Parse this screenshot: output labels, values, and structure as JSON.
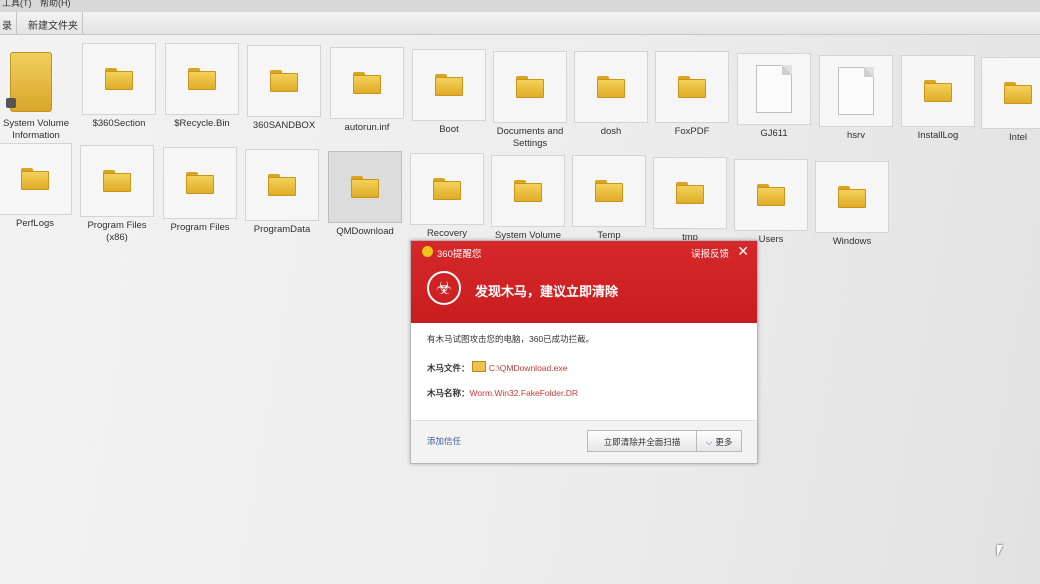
{
  "menubar": {
    "tools": "工具(T)",
    "help": "帮助(H)"
  },
  "toolbar": {
    "left_fragment": "录",
    "new_folder": "新建文件夹"
  },
  "files_row1": [
    {
      "name": "System Volume\nInformation",
      "type": "big-folder"
    },
    {
      "name": "$360Section",
      "type": "folder"
    },
    {
      "name": "$Recycle.Bin",
      "type": "folder"
    },
    {
      "name": "360SANDBOX",
      "type": "folder"
    },
    {
      "name": "autorun.inf",
      "type": "folder"
    },
    {
      "name": "Boot",
      "type": "folder"
    },
    {
      "name": "Documents and\nSettings",
      "type": "folder"
    },
    {
      "name": "dosh",
      "type": "folder"
    },
    {
      "name": "FoxPDF",
      "type": "folder"
    },
    {
      "name": "GJ611",
      "type": "file"
    },
    {
      "name": "hsrv",
      "type": "file"
    },
    {
      "name": "InstallLog",
      "type": "folder"
    },
    {
      "name": "Intel",
      "type": "folder"
    }
  ],
  "files_row2": [
    {
      "name": "PerfLogs",
      "type": "folder"
    },
    {
      "name": "Program Files\n(x86)",
      "type": "folder"
    },
    {
      "name": "Program Files",
      "type": "folder"
    },
    {
      "name": "ProgramData",
      "type": "folder"
    },
    {
      "name": "QMDownload",
      "type": "folder",
      "selected": true
    },
    {
      "name": "Recovery",
      "type": "folder"
    },
    {
      "name": "System Volume",
      "type": "folder"
    },
    {
      "name": "Temp",
      "type": "folder"
    },
    {
      "name": "tmp",
      "type": "folder"
    },
    {
      "name": "Users",
      "type": "folder"
    },
    {
      "name": "Windows",
      "type": "folder"
    }
  ],
  "popup": {
    "title": "360提醒您",
    "feedback": "误报反馈",
    "close": "✕",
    "headline": "发现木马，建议立即清除",
    "message": "有木马试图攻击您的电脑，360已成功拦截。",
    "file_label": "木马文件：",
    "file_value": "C:\\QMDownload.exe",
    "name_label": "木马名称：",
    "name_value": "Worm.Win32.FakeFolder.DR",
    "add_trust": "添加信任",
    "clean_button": "立即清除并全面扫描",
    "more_button": "更多",
    "accent": "#d1232a"
  }
}
